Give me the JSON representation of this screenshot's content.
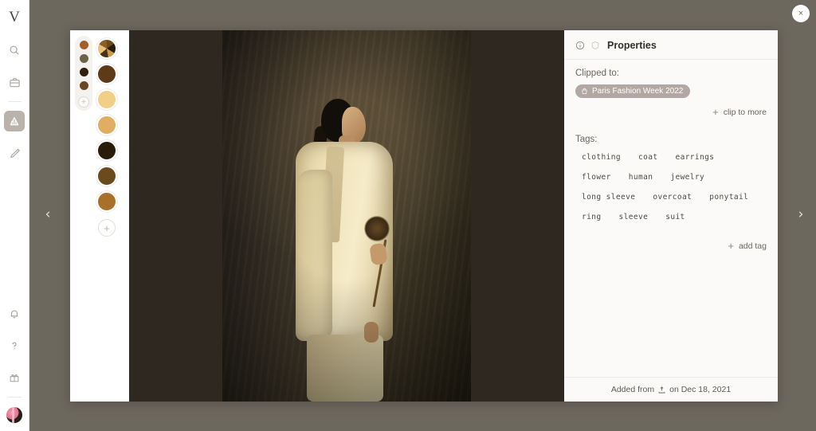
{
  "app": {
    "logo": "V",
    "rail_items": [
      {
        "name": "search-icon",
        "label": "Search",
        "active": false
      },
      {
        "name": "briefcase-icon",
        "label": "Projects",
        "active": false
      },
      {
        "name": "library-icon",
        "label": "Library",
        "active": true
      },
      {
        "name": "pen-icon",
        "label": "Draw",
        "active": false
      }
    ],
    "rail_bottom_items": [
      {
        "name": "bell-icon",
        "label": "Notifications"
      },
      {
        "name": "help-icon",
        "label": "Help"
      },
      {
        "name": "gift-icon",
        "label": "Rewards"
      }
    ],
    "avatar_label": "Account"
  },
  "overlay": {
    "close_label": "×",
    "prev_label": "‹",
    "next_label": "›"
  },
  "swatches": {
    "mini_colors": [
      "#a45f28",
      "#6b6347",
      "#2e1f0f",
      "#6b4620"
    ],
    "mini_add_label": "+",
    "big": [
      {
        "name": "swatch-palette-mixed",
        "color": "conic"
      },
      {
        "name": "swatch-brown",
        "color": "#5e3a17"
      },
      {
        "name": "swatch-light-tan",
        "color": "#f2cf86"
      },
      {
        "name": "swatch-tan",
        "color": "#e0ad62"
      },
      {
        "name": "swatch-dark-brown",
        "color": "#2a1c0b"
      },
      {
        "name": "swatch-medium-brown",
        "color": "#6b4a1c"
      },
      {
        "name": "swatch-caramel",
        "color": "#a9702c"
      }
    ],
    "big_add_label": "+"
  },
  "properties": {
    "header_title": "Properties",
    "header_icons": [
      "info-icon",
      "shield-icon"
    ],
    "clipped_to_label": "Clipped to:",
    "clipped_chip": "Paris Fashion Week 2022",
    "clip_to_more_label": "clip to more",
    "clip_to_more_plus": "+",
    "tags_label": "Tags:",
    "tags": [
      "clothing",
      "coat",
      "earrings",
      "flower",
      "human",
      "jewelry",
      "long sleeve",
      "overcoat",
      "ponytail",
      "ring",
      "sleeve",
      "suit"
    ],
    "add_tag_label": "add tag",
    "add_tag_plus": "+",
    "footer_prefix": "Added from",
    "footer_suffix": "on Dec 18, 2021",
    "footer_icon": "upload-icon"
  },
  "colors": {
    "backdrop": "#6d685e",
    "panel_bg": "#fbfaf8",
    "chip_bg": "#b2a7a2",
    "stage_bg": "#2c2620"
  }
}
